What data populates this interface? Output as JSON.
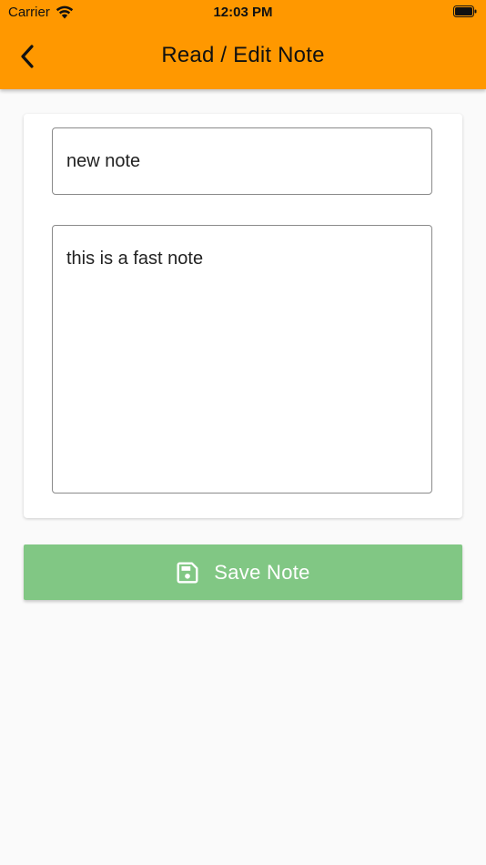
{
  "status_bar": {
    "carrier": "Carrier",
    "time": "12:03 PM"
  },
  "app_bar": {
    "title": "Read / Edit Note",
    "back_icon": "chevron-left-icon"
  },
  "form": {
    "title_value": "new note",
    "content_value": "this is a fast note"
  },
  "save_button": {
    "label": "Save Note",
    "icon": "save-icon"
  },
  "colors": {
    "app_bar": "#ff9800",
    "save_button": "#81c784",
    "background": "#fafafa"
  }
}
